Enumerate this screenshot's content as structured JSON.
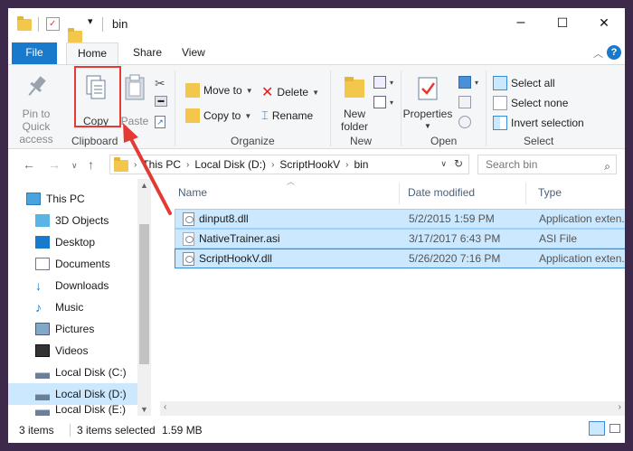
{
  "window": {
    "title": "bin",
    "minimize": "–",
    "maximize": "☐",
    "close": "✕"
  },
  "tabs": {
    "file": "File",
    "home": "Home",
    "share": "Share",
    "view": "View"
  },
  "ribbon": {
    "clipboard": {
      "label": "Clipboard",
      "pin_label_1": "Pin to Quick",
      "pin_label_2": "access",
      "copy": "Copy",
      "paste": "Paste"
    },
    "organize": {
      "label": "Organize",
      "move_to": "Move to",
      "copy_to": "Copy to",
      "delete": "Delete",
      "rename": "Rename"
    },
    "new": {
      "label": "New",
      "new_folder_1": "New",
      "new_folder_2": "folder"
    },
    "open": {
      "label": "Open",
      "properties": "Properties"
    },
    "select": {
      "label": "Select",
      "select_all": "Select all",
      "select_none": "Select none",
      "invert_selection": "Invert selection"
    }
  },
  "address": {
    "crumbs": [
      "This PC",
      "Local Disk (D:)",
      "ScriptHookV",
      "bin"
    ],
    "search_placeholder": "Search bin"
  },
  "nav": {
    "items": [
      {
        "label": "This PC",
        "icon": "computer-icon"
      },
      {
        "label": "3D Objects",
        "icon": "cube-icon"
      },
      {
        "label": "Desktop",
        "icon": "desktop-icon"
      },
      {
        "label": "Documents",
        "icon": "document-icon"
      },
      {
        "label": "Downloads",
        "icon": "download-icon"
      },
      {
        "label": "Music",
        "icon": "music-icon"
      },
      {
        "label": "Pictures",
        "icon": "pictures-icon"
      },
      {
        "label": "Videos",
        "icon": "video-icon"
      },
      {
        "label": "Local Disk (C:)",
        "icon": "drive-icon"
      },
      {
        "label": "Local Disk (D:)",
        "icon": "drive-icon"
      },
      {
        "label": "Local Disk  (E:)",
        "icon": "drive-icon"
      }
    ],
    "selected_index": 9
  },
  "files": {
    "columns": [
      "Name",
      "Date modified",
      "Type"
    ],
    "rows": [
      {
        "name": "dinput8.dll",
        "date": "5/2/2015 1:59 PM",
        "type": "Application exten..."
      },
      {
        "name": "NativeTrainer.asi",
        "date": "3/17/2017 6:43 PM",
        "type": "ASI File"
      },
      {
        "name": "ScriptHookV.dll",
        "date": "5/26/2020 7:16 PM",
        "type": "Application exten..."
      }
    ]
  },
  "status": {
    "items": "3 items",
    "selected": "3 items selected",
    "size": "1.59 MB"
  },
  "colors": {
    "accent": "#1979ca",
    "selection": "#cce8ff",
    "annotation": "#e53935"
  }
}
